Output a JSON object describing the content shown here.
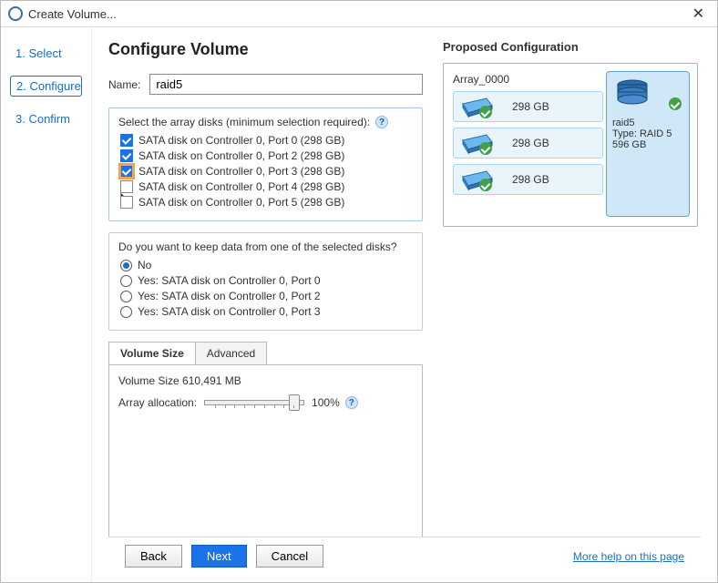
{
  "window": {
    "title": "Create Volume..."
  },
  "sidebar": {
    "steps": [
      {
        "label": "1. Select"
      },
      {
        "label": "2. Configure"
      },
      {
        "label": "3. Confirm"
      }
    ],
    "active_index": 1
  },
  "page": {
    "title": "Configure Volume",
    "name_label": "Name:",
    "name_value": "raid5",
    "disk_select_label": "Select the array disks (minimum selection required):",
    "disks": [
      {
        "label": "SATA disk on Controller 0, Port 0 (298 GB)",
        "checked": true
      },
      {
        "label": "SATA disk on Controller 0, Port 2 (298 GB)",
        "checked": true
      },
      {
        "label": "SATA disk on Controller 0, Port 3 (298 GB)",
        "checked": true,
        "highlight": true
      },
      {
        "label": "SATA disk on Controller 0, Port 4 (298 GB)",
        "checked": false,
        "cursor": true
      },
      {
        "label": "SATA disk on Controller 0, Port 5 (298 GB)",
        "checked": false
      }
    ],
    "keep_data_label": "Do you want to keep data from one of the selected disks?",
    "keep_options": [
      {
        "label": "No",
        "checked": true
      },
      {
        "label": "Yes: SATA disk on Controller 0, Port 0",
        "checked": false
      },
      {
        "label": "Yes: SATA disk on Controller 0, Port 2",
        "checked": false
      },
      {
        "label": "Yes: SATA disk on Controller 0, Port 3",
        "checked": false
      }
    ],
    "tabs": [
      {
        "label": "Volume Size",
        "active": true
      },
      {
        "label": "Advanced",
        "active": false
      }
    ],
    "volume_size_label": "Volume Size",
    "volume_size_value": "610,491 MB",
    "alloc_label": "Array allocation:",
    "alloc_percent": "100%"
  },
  "proposed": {
    "title": "Proposed Configuration",
    "array_name": "Array_0000",
    "disks": [
      {
        "size": "298 GB"
      },
      {
        "size": "298 GB"
      },
      {
        "size": "298 GB"
      }
    ],
    "volume": {
      "name": "raid5",
      "type_label": "Type: RAID 5",
      "size": "596 GB"
    }
  },
  "footer": {
    "back": "Back",
    "next": "Next",
    "cancel": "Cancel",
    "help": "More help on this page"
  }
}
